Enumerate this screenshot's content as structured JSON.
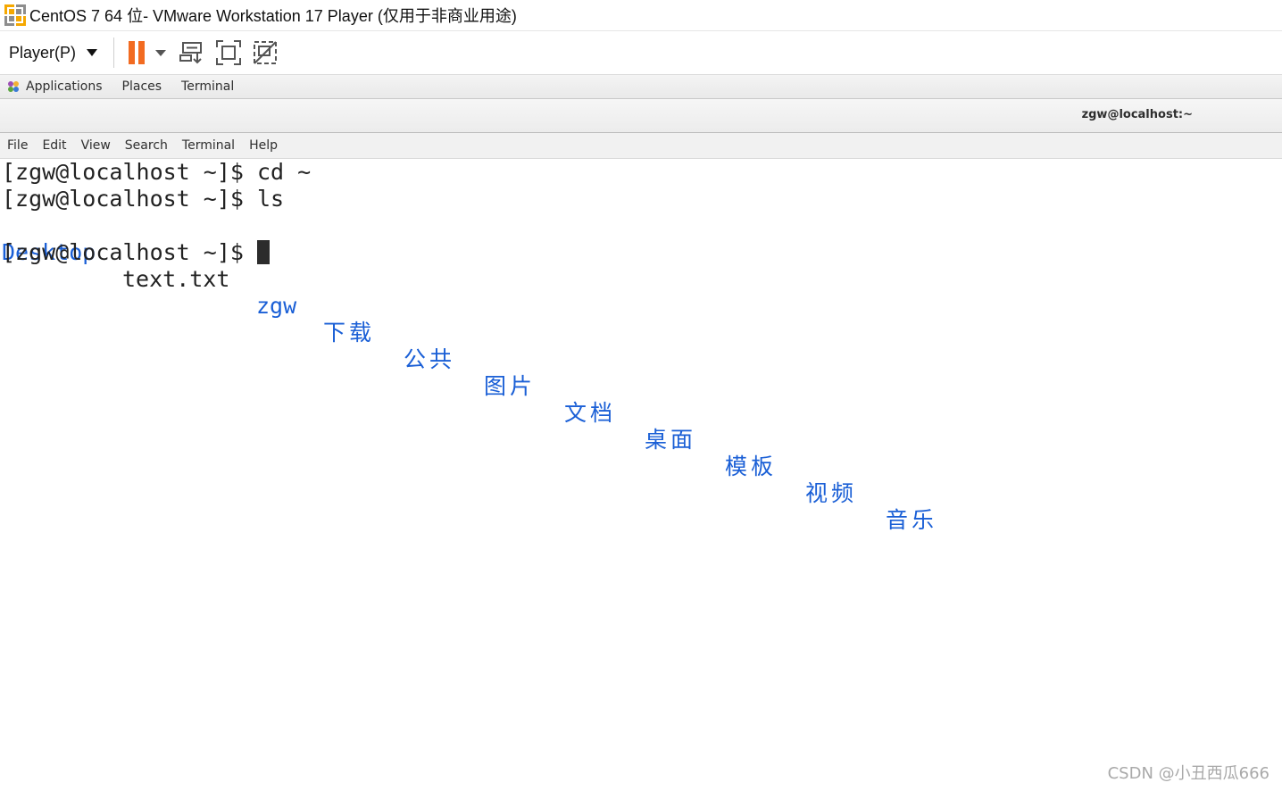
{
  "window": {
    "title": "CentOS 7 64 位- VMware Workstation 17 Player (仅用于非商业用途)"
  },
  "toolbar": {
    "player_menu_label": "Player(P)",
    "icons": [
      "pause-icon",
      "send-ctrl-alt-del-icon",
      "fullscreen-icon",
      "unity-icon"
    ],
    "accent_color": "#f26b21"
  },
  "gnome_panel": {
    "applications_label": "Applications",
    "places_label": "Places",
    "terminal_label": "Terminal"
  },
  "terminal_window": {
    "title": "zgw@localhost:~"
  },
  "terminal_menu": {
    "items": [
      "File",
      "Edit",
      "View",
      "Search",
      "Terminal",
      "Help"
    ]
  },
  "terminal": {
    "line1": "[zgw@localhost ~]$ cd ~",
    "line2": "[zgw@localhost ~]$ ls",
    "ls_output": [
      "Desktop",
      "text.txt",
      "zgw",
      "下载",
      "公共",
      "图片",
      "文档",
      "桌面",
      "模板",
      "视频",
      "音乐"
    ],
    "prompt": "[zgw@localhost ~]$ ",
    "directory_color": "#1a5fd6"
  },
  "watermark": "CSDN @小丑西瓜666"
}
